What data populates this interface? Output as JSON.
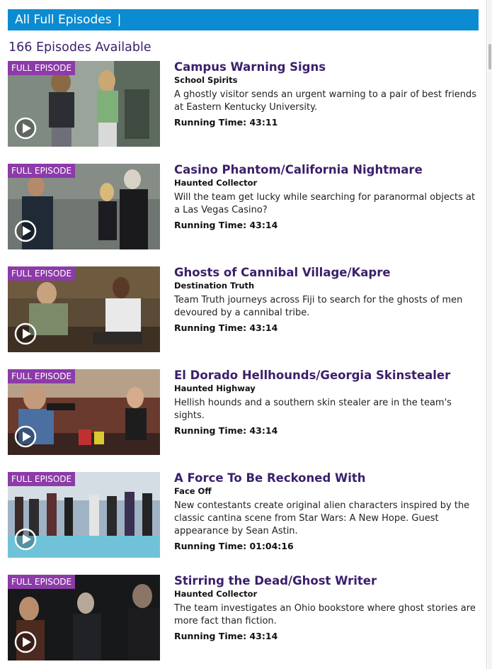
{
  "header": {
    "title": "All Full Episodes",
    "separator": "|"
  },
  "count_text": "166 Episodes Available",
  "badge_label": "FULL EPISODE",
  "running_time_label": "Running Time:",
  "episodes": [
    {
      "title": "Campus Warning Signs",
      "show": "School Spirits",
      "description": "A ghostly visitor sends an urgent warning to a pair of best friends at Eastern Kentucky University.",
      "running_time": "43:11"
    },
    {
      "title": "Casino Phantom/California Nightmare",
      "show": "Haunted Collector",
      "description": "Will the team get lucky while searching for paranormal objects at a Las Vegas Casino?",
      "running_time": "43:14"
    },
    {
      "title": "Ghosts of Cannibal Village/Kapre",
      "show": "Destination Truth",
      "description": "Team Truth journeys across Fiji to search for the ghosts of men devoured by a cannibal tribe.",
      "running_time": "43:14"
    },
    {
      "title": "El Dorado Hellhounds/Georgia Skinstealer",
      "show": "Haunted Highway",
      "description": "Hellish hounds and a southern skin stealer are in the team's sights.",
      "running_time": "43:14"
    },
    {
      "title": "A Force To Be Reckoned With",
      "show": "Face Off",
      "description": "New contestants create original alien characters inspired by the classic cantina scene from Star Wars: A New Hope. Guest appearance by Sean Astin.",
      "running_time": "01:04:16"
    },
    {
      "title": "Stirring the Dead/Ghost Writer",
      "show": "Haunted Collector",
      "description": "The team investigates an Ohio bookstore where ghost stories are more fact than fiction.",
      "running_time": "43:14"
    }
  ],
  "colors": {
    "header_bg": "#0b8bd1",
    "title": "#3b1f6b",
    "badge": "#8c3ba8"
  }
}
